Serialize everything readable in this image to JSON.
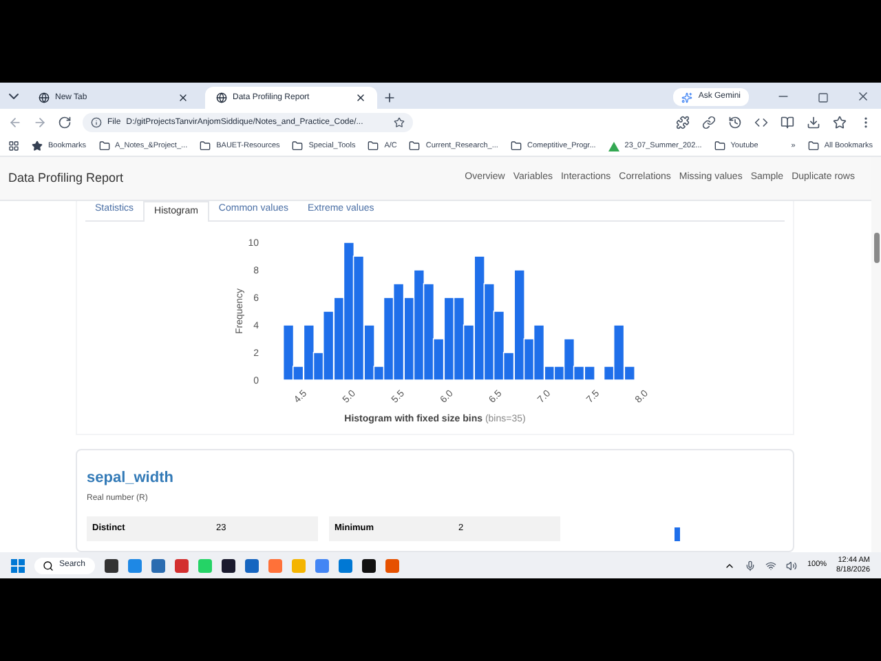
{
  "browser": {
    "tabs": [
      {
        "label": "New Tab",
        "selected": false
      },
      {
        "label": "Data Profiling Report",
        "selected": true
      }
    ],
    "ask_button": "Ask Gemini",
    "address": {
      "scheme": "File",
      "url": "D:/gitProjectsTanvirAnjomSiddique/Notes_and_Practice_Code/..."
    },
    "bookmarks": [
      {
        "label": "Bookmarks",
        "kind": "star"
      },
      {
        "label": "A_Notes_&Project_...",
        "kind": "folder"
      },
      {
        "label": "BAUET-Resources",
        "kind": "folder"
      },
      {
        "label": "Special_Tools",
        "kind": "folder"
      },
      {
        "label": "A/C",
        "kind": "folder"
      },
      {
        "label": "Current_Research_...",
        "kind": "folder"
      },
      {
        "label": "Comeptitive_Progr...",
        "kind": "folder"
      },
      {
        "label": "23_07_Summer_202...",
        "kind": "drive"
      },
      {
        "label": "Youtube",
        "kind": "folder"
      }
    ],
    "overflow": "»",
    "all_bookmarks": "All Bookmarks"
  },
  "page": {
    "title": "Data Profiling Report",
    "nav": [
      "Overview",
      "Variables",
      "Interactions",
      "Correlations",
      "Missing values",
      "Sample",
      "Duplicate rows"
    ],
    "section_tabs": [
      {
        "label": "Statistics",
        "selected": false
      },
      {
        "label": "Histogram",
        "selected": true
      },
      {
        "label": "Common values",
        "selected": false
      },
      {
        "label": "Extreme values",
        "selected": false
      }
    ],
    "chart_data": {
      "type": "bar",
      "ylabel": "Frequency",
      "x": [
        4.35,
        4.45,
        4.56,
        4.66,
        4.76,
        4.87,
        4.97,
        5.07,
        5.18,
        5.28,
        5.38,
        5.48,
        5.59,
        5.69,
        5.79,
        5.89,
        6.0,
        6.1,
        6.2,
        6.31,
        6.41,
        6.51,
        6.61,
        6.72,
        6.82,
        6.92,
        7.03,
        7.13,
        7.23,
        7.33,
        7.44,
        7.54,
        7.64,
        7.74,
        7.85
      ],
      "values": [
        4,
        1,
        4,
        2,
        5,
        6,
        10,
        9,
        4,
        1,
        6,
        7,
        6,
        8,
        7,
        3,
        6,
        6,
        4,
        9,
        7,
        5,
        2,
        8,
        3,
        4,
        1,
        1,
        3,
        1,
        1,
        0,
        1,
        4,
        1
      ],
      "xlim": [
        4.3,
        8.0
      ],
      "ylim": [
        0,
        10
      ],
      "xticks": [
        {
          "value": 4.5,
          "label": "4.5"
        },
        {
          "value": 5,
          "label": "5.0"
        },
        {
          "value": 5.5,
          "label": "5.5"
        },
        {
          "value": 6,
          "label": "6.0"
        },
        {
          "value": 6.5,
          "label": "6.5"
        },
        {
          "value": 7,
          "label": "7.0"
        },
        {
          "value": 7.5,
          "label": "7.5"
        },
        {
          "value": 8,
          "label": "8.0"
        }
      ],
      "yticks": [
        0,
        2,
        4,
        6,
        8,
        10
      ]
    },
    "caption": "Histogram with fixed size bins",
    "caption_note": "(bins=35)",
    "variable": {
      "name": "sepal_width",
      "type": "Real number (R)",
      "stats": [
        {
          "label": "Distinct",
          "value": "23"
        },
        {
          "label": "Minimum",
          "value": "2"
        }
      ]
    }
  },
  "taskbar": {
    "search": "Search",
    "time": "12:44 AM",
    "date": "8/18/2026",
    "battery": "100%"
  }
}
